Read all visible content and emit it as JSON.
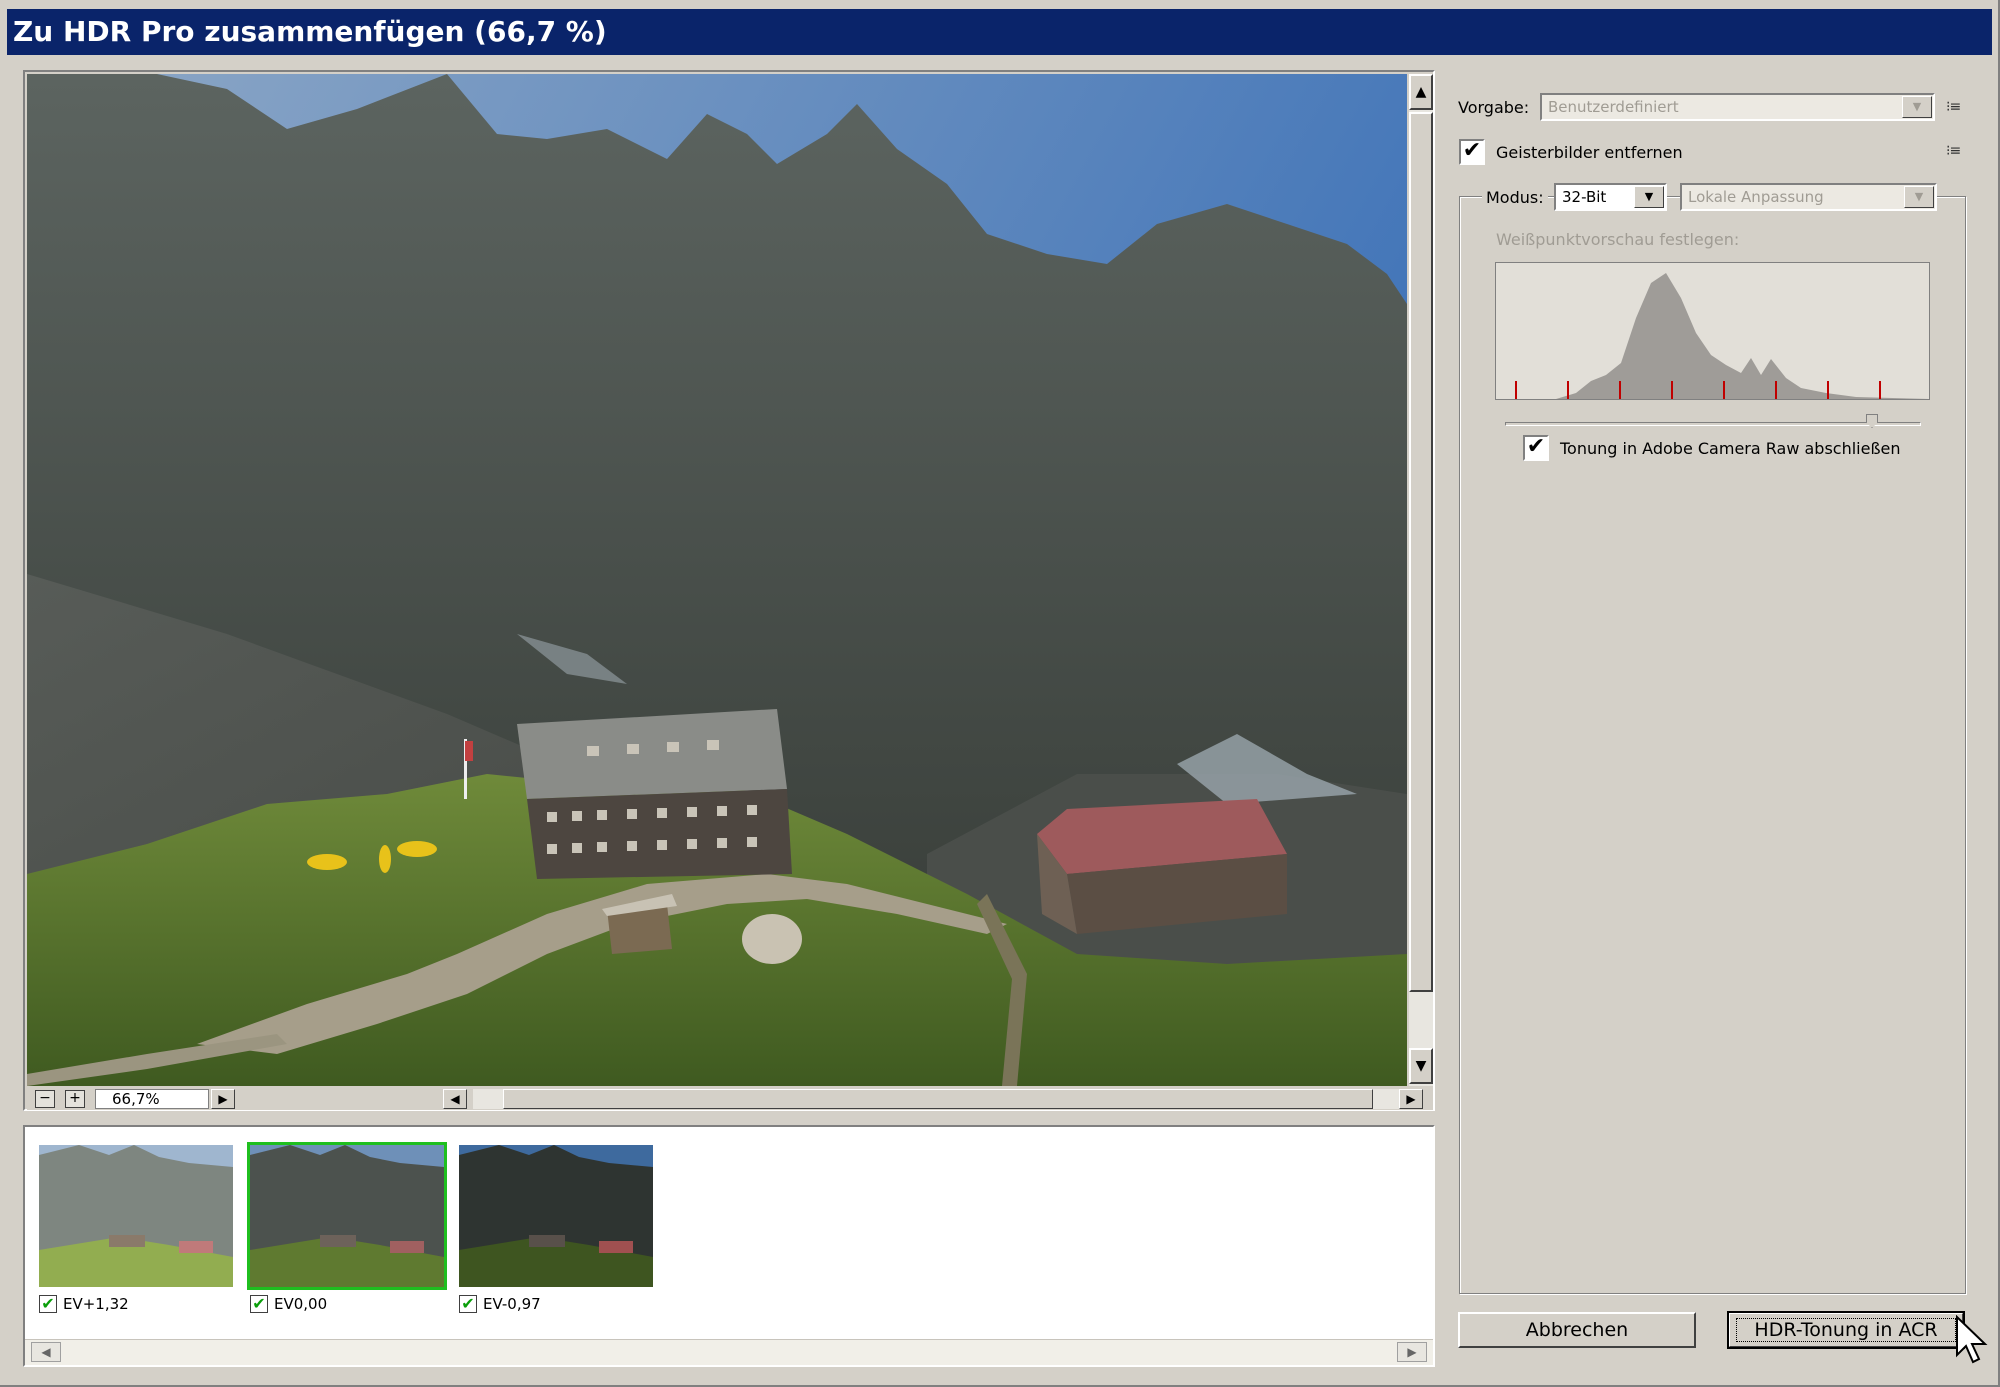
{
  "window": {
    "title": "Zu HDR Pro zusammenfügen (66,7 %)"
  },
  "preview": {
    "zoom": "66,7%",
    "zoom_out_icon": "minus-icon",
    "zoom_in_icon": "plus-icon"
  },
  "filmstrip": {
    "items": [
      {
        "label": "EV+1,32",
        "checked": true,
        "selected": false
      },
      {
        "label": "EV0,00",
        "checked": true,
        "selected": true
      },
      {
        "label": "EV-0,97",
        "checked": true,
        "selected": false
      }
    ]
  },
  "panel": {
    "preset_label": "Vorgabe:",
    "preset_value": "Benutzerdefiniert",
    "remove_ghosts_label": "Geisterbilder entfernen",
    "remove_ghosts_checked": true,
    "mode_label": "Modus:",
    "mode_value": "32-Bit",
    "method_value": "Lokale Anpassung",
    "whitepoint_label": "Weißpunktvorschau festlegen:",
    "acr_toning_label": "Tonung in Adobe Camera Raw abschließen",
    "acr_toning_checked": true
  },
  "buttons": {
    "cancel": "Abbrechen",
    "ok": "HDR-Tonung in ACR"
  },
  "colors": {
    "titlebar": "#0a246a",
    "dialog_bg": "#d4d0c8",
    "selection": "#1fbf1f",
    "histogram_marker": "#c00000"
  }
}
